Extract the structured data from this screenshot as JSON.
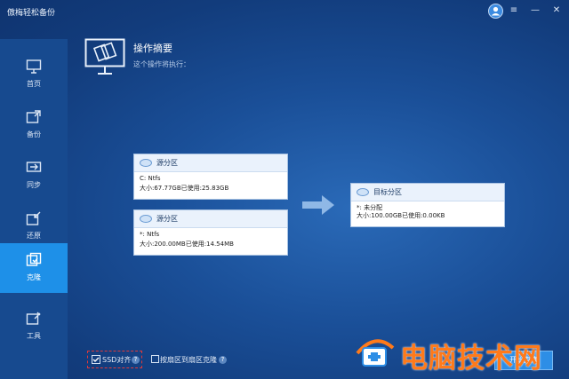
{
  "app": {
    "title": "傲梅轻松备份",
    "window_controls": [
      "≡",
      "—",
      "✕"
    ]
  },
  "sidebar": {
    "items": [
      {
        "label": "首页",
        "icon": "home-monitor-icon",
        "active": false
      },
      {
        "label": "备份",
        "icon": "backup-icon",
        "active": false
      },
      {
        "label": "同步",
        "icon": "sync-icon",
        "active": false
      },
      {
        "label": "还原",
        "icon": "restore-icon",
        "active": false
      },
      {
        "label": "克隆",
        "icon": "clone-icon",
        "active": true
      },
      {
        "label": "工具",
        "icon": "tools-icon",
        "active": false
      }
    ]
  },
  "header": {
    "title": "操作摘要",
    "subtitle": "这个操作将执行："
  },
  "source": {
    "partitions": [
      {
        "name": "源分区",
        "line1": "C: Ntfs",
        "line2": "大小:67.77GB已使用:25.83GB"
      },
      {
        "name": "源分区",
        "line1": "*: Ntfs",
        "line2": "大小:200.00MB已使用:14.54MB"
      }
    ]
  },
  "destination": {
    "name": "目标分区",
    "line1": "*: 未分配",
    "line2": "大小:100.00GB已使用:0.00KB"
  },
  "footer": {
    "ssd_label": "SSD对齐",
    "ssd_checked": true,
    "sector_label": "按扇区到扇区克隆",
    "sector_checked": false,
    "next_button": "开始克隆"
  },
  "watermark": {
    "text": "电脑技术网"
  },
  "colors": {
    "accent": "#1e90e8",
    "sidebar": "#174a8f",
    "highlight": "#e23a3a",
    "watermark": "#ff7a1a"
  }
}
